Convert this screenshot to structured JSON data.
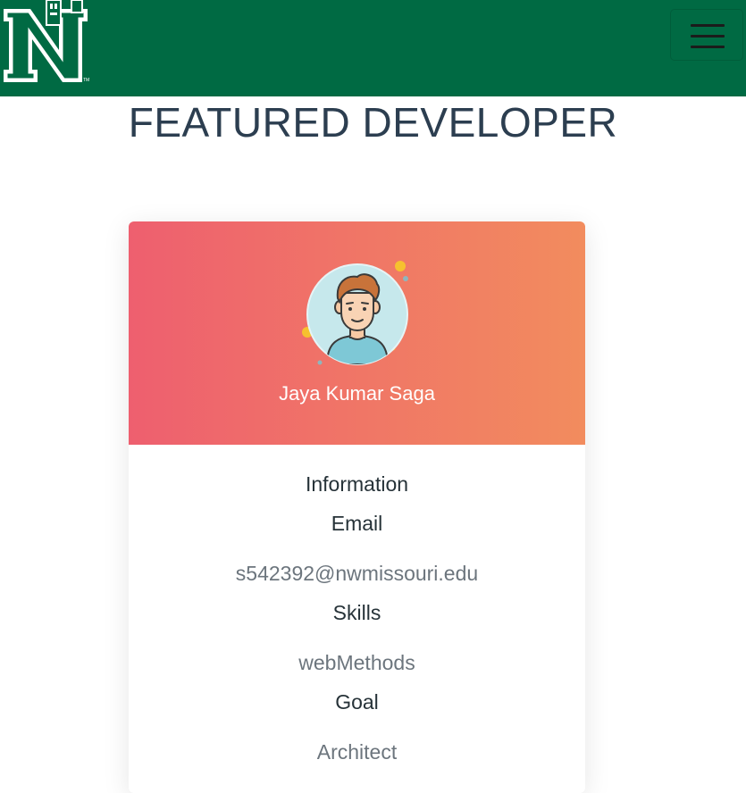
{
  "navbar": {
    "logo_letter": "N",
    "logo_mark": "TM",
    "brand_color": "#006a43",
    "toggler_icon": "hamburger-menu-icon"
  },
  "page": {
    "title": "FEATURED DEVELOPER"
  },
  "developer": {
    "name": "Jaya Kumar Saga",
    "avatar_icon": "developer-avatar-icon",
    "header_gradient": [
      "#ee5f6f",
      "#f28c5e"
    ]
  },
  "info": {
    "section_title": "Information",
    "email_label": "Email",
    "email_value": "s542392@nwmissouri.edu",
    "skills_label": "Skills",
    "skills_value": "webMethods",
    "goal_label": "Goal",
    "goal_value": "Architect"
  }
}
